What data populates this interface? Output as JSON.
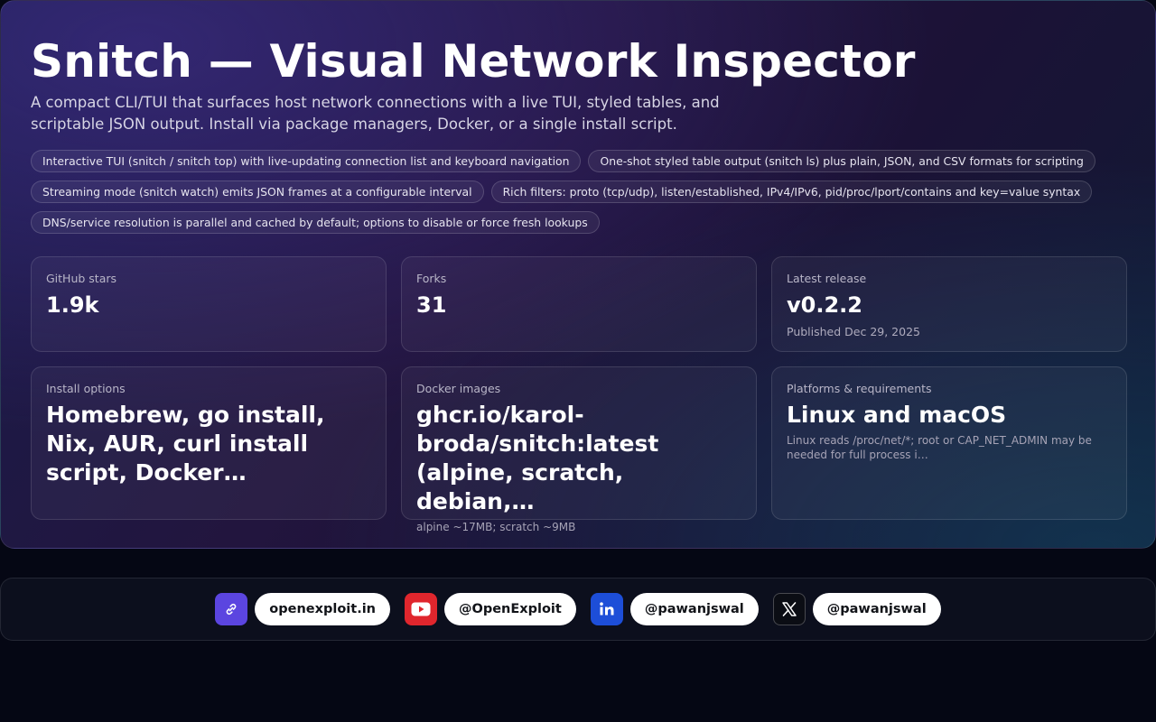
{
  "header": {
    "title": "Snitch — Visual Network Inspector",
    "subtitle": "A compact CLI/TUI that surfaces host network connections with a live TUI, styled tables, and scriptable JSON output. Install via package managers, Docker, or a single install script."
  },
  "features": [
    "Interactive TUI (snitch / snitch top) with live-updating connection list and keyboard navigation",
    "One-shot styled table output (snitch ls) plus plain, JSON, and CSV formats for scripting",
    "Streaming mode (snitch watch) emits JSON frames at a configurable interval",
    "Rich filters: proto (tcp/udp), listen/established, IPv4/IPv6, pid/proc/lport/contains and key=value syntax",
    "DNS/service resolution is parallel and cached by default; options to disable or force fresh lookups"
  ],
  "stats": {
    "stars": {
      "label": "GitHub stars",
      "value": "1.9k"
    },
    "forks": {
      "label": "Forks",
      "value": "31"
    },
    "release": {
      "label": "Latest release",
      "value": "v0.2.2",
      "note": "Published Dec 29, 2025"
    }
  },
  "details": {
    "install": {
      "label": "Install options",
      "value": "Homebrew, go install, Nix, AUR, curl install script, Docker…"
    },
    "docker": {
      "label": "Docker images",
      "value": "ghcr.io/karol-broda/snitch:latest (alpine, scratch, debian,…",
      "note": "alpine ~17MB; scratch ~9MB"
    },
    "platforms": {
      "label": "Platforms & requirements",
      "value": "Linux and macOS",
      "note": "Linux reads /proc/net/*; root or CAP_NET_ADMIN may be needed for full process i…"
    }
  },
  "footer": {
    "website": {
      "icon": "link-icon",
      "label": "openexploit.in",
      "color": "#5b45e0"
    },
    "youtube": {
      "icon": "youtube-icon",
      "label": "@OpenExploit",
      "color": "#e0262d"
    },
    "linkedin": {
      "icon": "linkedin-icon",
      "label": "@pawanjswal",
      "color": "#1d4ed8"
    },
    "x": {
      "icon": "x-icon",
      "label": "@pawanjswal",
      "color": "#0b0d14"
    }
  }
}
